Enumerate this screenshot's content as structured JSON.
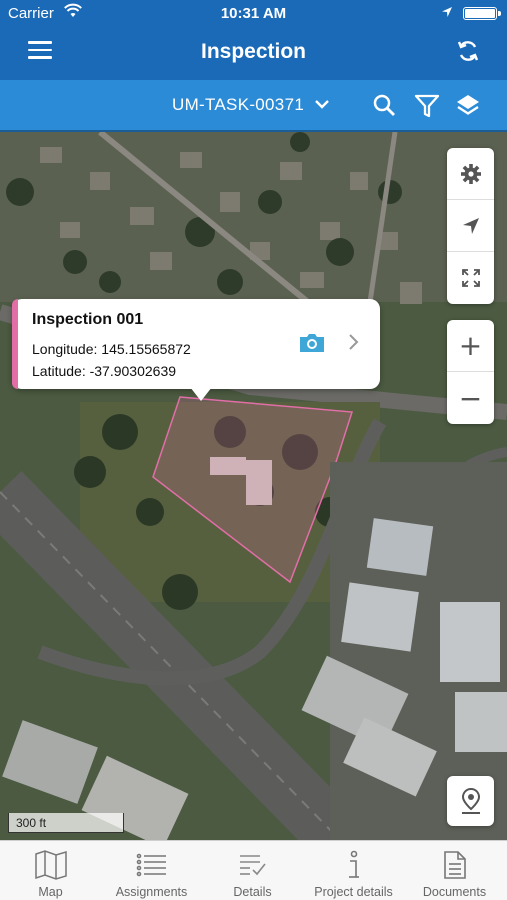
{
  "status_bar": {
    "carrier": "Carrier",
    "time": "10:31 AM"
  },
  "nav": {
    "title": "Inspection",
    "menu_icon": "hamburger-menu-icon",
    "sync_icon": "sync-icon"
  },
  "toolbar": {
    "task_label": "UM-TASK-00371",
    "icons": [
      "search-icon",
      "filter-icon",
      "layers-icon"
    ]
  },
  "popup": {
    "title": "Inspection 001",
    "longitude": "Longitude: 145.15565872",
    "latitude": "Latitude: -37.90302639",
    "accent_color": "#e26ea7"
  },
  "map": {
    "scale_label": "300 ft",
    "controls": [
      "settings-icon",
      "navigate-icon",
      "fullscreen-icon"
    ],
    "zoom_in": "+",
    "zoom_out": "−",
    "polygon_color": "#e26ea7"
  },
  "tabs": [
    {
      "label": "Map",
      "icon": "map-icon"
    },
    {
      "label": "Assignments",
      "icon": "list-icon"
    },
    {
      "label": "Details",
      "icon": "details-check-icon"
    },
    {
      "label": "Project details",
      "icon": "info-icon"
    },
    {
      "label": "Documents",
      "icon": "document-icon"
    }
  ],
  "colors": {
    "nav_bar": "#1b6ab8",
    "toolbar": "#2b8bd6",
    "tab_bar": "#f7f7f7"
  }
}
